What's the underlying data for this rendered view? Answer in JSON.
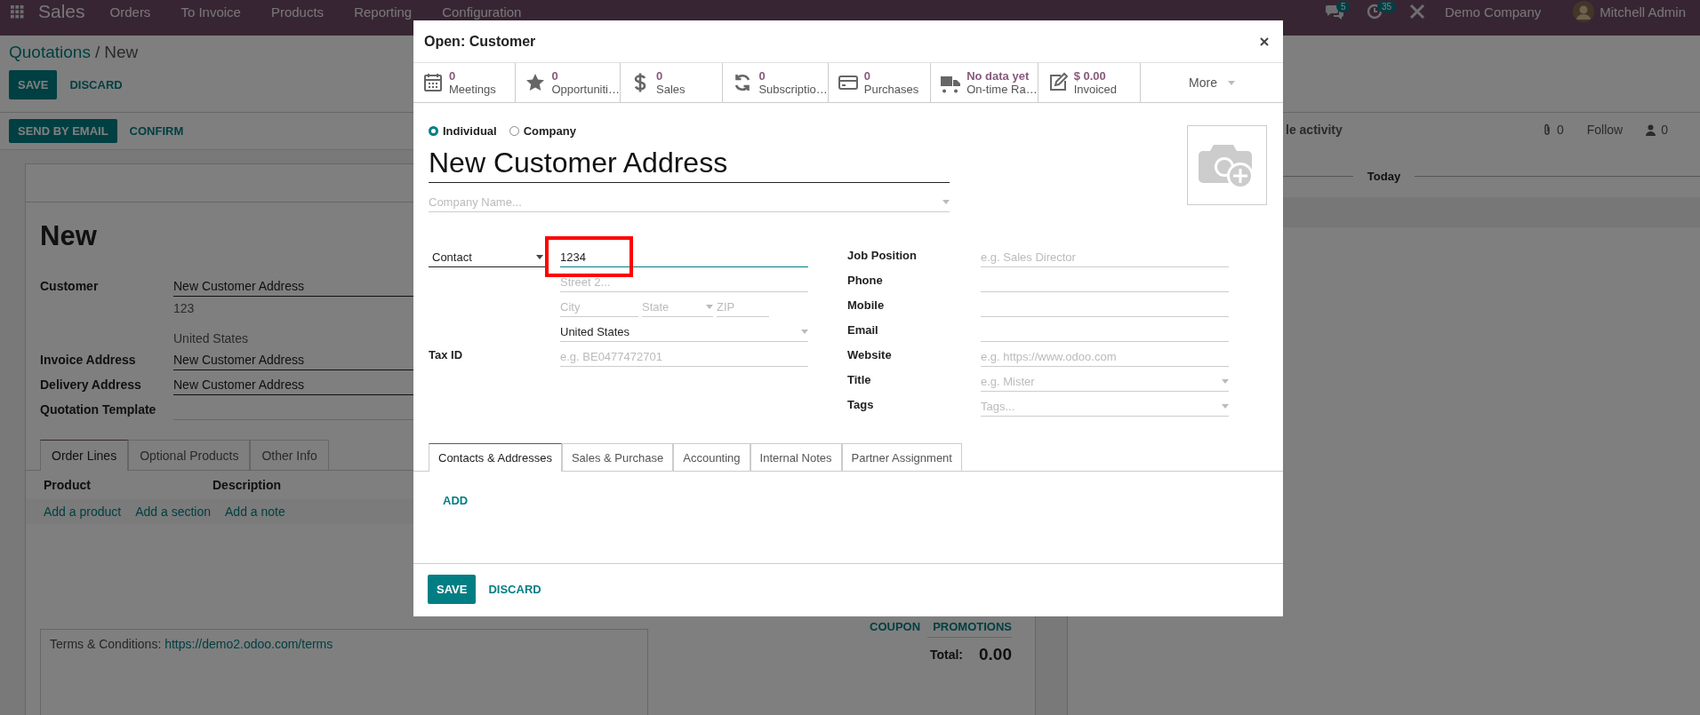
{
  "top_bar": {
    "app": "Sales",
    "menu": [
      "Orders",
      "To Invoice",
      "Products",
      "Reporting",
      "Configuration"
    ],
    "messages_count": "5",
    "activities_count": "35",
    "company": "Demo Company",
    "user": "Mitchell Admin"
  },
  "breadcrumb": {
    "parent": "Quotations",
    "separator": "/",
    "current": "New"
  },
  "actions": [
    "SAVE",
    "DISCARD"
  ],
  "status_actions": [
    "SEND BY EMAIL",
    "CONFIRM"
  ],
  "form": {
    "title": "New",
    "customer": {
      "label": "Customer",
      "value": "New Customer Address",
      "street": "123",
      "country": "United States"
    },
    "fields": [
      {
        "label": "Invoice Address",
        "value": "New Customer Address"
      },
      {
        "label": "Delivery Address",
        "value": "New Customer Address"
      },
      {
        "label": "Quotation Template"
      }
    ]
  },
  "tabs": [
    {
      "label": "Order Lines",
      "selected": true
    },
    {
      "label": "Optional Products",
      "selected": false
    },
    {
      "label": "Other Info",
      "selected": false
    }
  ],
  "table": {
    "columns": [
      "Product",
      "Description"
    ],
    "add_links": [
      "Add a product",
      "Add a section",
      "Add a note"
    ]
  },
  "terms": {
    "label": "Terms & Conditions:",
    "link": "https://demo2.odoo.com/terms"
  },
  "promo_buttons": [
    "COUPON",
    "PROMOTIONS"
  ],
  "total": {
    "label": "Total:",
    "value": "0.00"
  },
  "chatter": {
    "activity": "le activity",
    "attachments": "0",
    "follow": "Follow",
    "followers": "0",
    "date_separator": "Today"
  },
  "dialog": {
    "title": "Open: Customer",
    "stat_buttons": [
      {
        "kind": "calendar",
        "value": "0",
        "label": "Meetings"
      },
      {
        "kind": "star",
        "value": "0",
        "label": "Opportuniti…"
      },
      {
        "kind": "dollar",
        "value": "0",
        "label": "Sales"
      },
      {
        "kind": "refresh",
        "value": "0",
        "label": "Subscriptio…"
      },
      {
        "kind": "card",
        "value": "0",
        "label": "Purchases"
      },
      {
        "kind": "truck",
        "value": "No data yet",
        "label": "On-time Ra…"
      },
      {
        "kind": "pencil",
        "value": "$ 0.00",
        "label": "Invoiced"
      }
    ],
    "more": "More",
    "company_type": [
      {
        "label": "Individual",
        "selected": true
      },
      {
        "label": "Company",
        "selected": false
      }
    ],
    "name": "New Customer Address",
    "company_placeholder": "Company Name...",
    "address_type": "Contact",
    "street": "1234",
    "street_highlighted": true,
    "street2_placeholder": "Street 2...",
    "city_placeholder": "City",
    "state_placeholder": "State",
    "zip_placeholder": "ZIP",
    "country": "United States",
    "tax_id": {
      "label": "Tax ID",
      "placeholder": "e.g. BE0477472701"
    },
    "right_fields": [
      {
        "label": "Job Position",
        "placeholder": "e.g. Sales Director",
        "kind": "text"
      },
      {
        "label": "Phone",
        "kind": "text"
      },
      {
        "label": "Mobile",
        "kind": "text"
      },
      {
        "label": "Email",
        "kind": "text"
      },
      {
        "label": "Website",
        "placeholder": "e.g. https://www.odoo.com",
        "kind": "text"
      },
      {
        "label": "Title",
        "placeholder": "e.g. Mister",
        "kind": "select"
      },
      {
        "label": "Tags",
        "placeholder": "Tags...",
        "kind": "select"
      }
    ],
    "tabs": [
      {
        "label": "Contacts & Addresses",
        "selected": true
      },
      {
        "label": "Sales & Purchase",
        "selected": false
      },
      {
        "label": "Accounting",
        "selected": false
      },
      {
        "label": "Internal Notes",
        "selected": false
      },
      {
        "label": "Partner Assignment",
        "selected": false
      }
    ],
    "add_label": "ADD",
    "buttons": [
      "SAVE",
      "DISCARD"
    ]
  }
}
